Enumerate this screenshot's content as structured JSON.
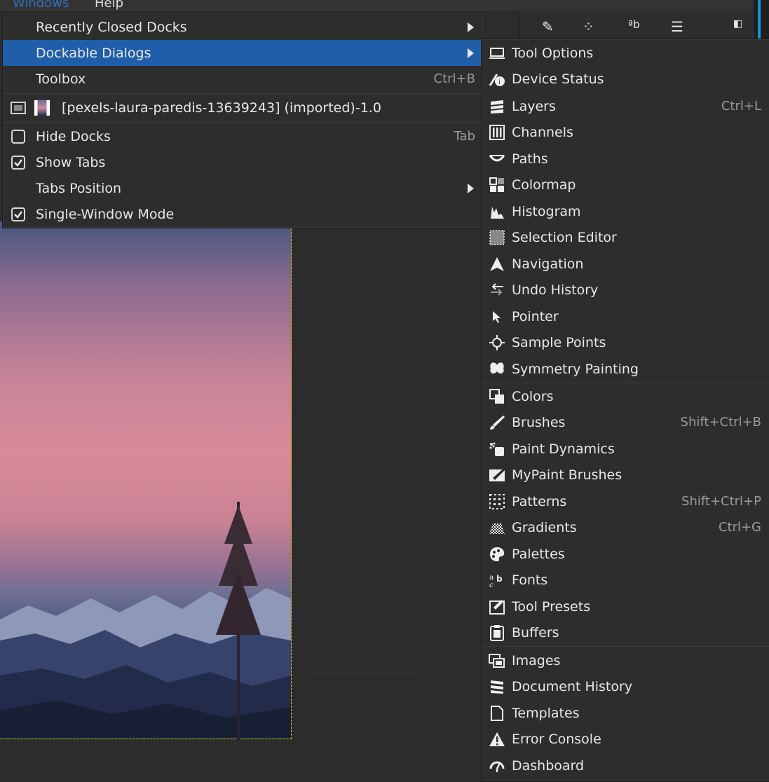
{
  "menubar": {
    "windows": "Windows",
    "help": "Help"
  },
  "windows_menu": {
    "items": [
      {
        "label": "Recently Closed Docks",
        "submenu": true
      },
      {
        "label": "Dockable Dialogs",
        "submenu": true,
        "active": true
      },
      {
        "label": "Toolbox",
        "shortcut": "Ctrl+B"
      },
      {
        "label": "[pexels-laura-paredis-13639243] (imported)-1.0"
      },
      {
        "label": "Hide Docks",
        "shortcut": "Tab",
        "checked": false
      },
      {
        "label": "Show Tabs",
        "checked": true
      },
      {
        "label": "Tabs Position",
        "submenu": true
      },
      {
        "label": "Single-Window Mode",
        "checked": true
      }
    ]
  },
  "dockable_dialogs": {
    "items": [
      {
        "label": "Tool Options",
        "icon": "tool-options-icon"
      },
      {
        "label": "Device Status",
        "icon": "device-status-icon"
      },
      {
        "label": "Layers",
        "shortcut": "Ctrl+L",
        "icon": "layers-icon"
      },
      {
        "label": "Channels",
        "icon": "channels-icon"
      },
      {
        "label": "Paths",
        "icon": "paths-icon"
      },
      {
        "label": "Colormap",
        "icon": "colormap-icon"
      },
      {
        "label": "Histogram",
        "icon": "histogram-icon"
      },
      {
        "label": "Selection Editor",
        "icon": "selection-editor-icon"
      },
      {
        "label": "Navigation",
        "icon": "navigation-icon"
      },
      {
        "label": "Undo History",
        "icon": "undo-history-icon"
      },
      {
        "label": "Pointer",
        "icon": "pointer-icon"
      },
      {
        "label": "Sample Points",
        "icon": "sample-points-icon"
      },
      {
        "label": "Symmetry Painting",
        "icon": "symmetry-painting-icon"
      },
      {
        "label": "Colors",
        "icon": "colors-icon"
      },
      {
        "label": "Brushes",
        "shortcut": "Shift+Ctrl+B",
        "icon": "brushes-icon"
      },
      {
        "label": "Paint Dynamics",
        "icon": "paint-dynamics-icon"
      },
      {
        "label": "MyPaint Brushes",
        "icon": "mypaint-brushes-icon"
      },
      {
        "label": "Patterns",
        "shortcut": "Shift+Ctrl+P",
        "icon": "patterns-icon"
      },
      {
        "label": "Gradients",
        "shortcut": "Ctrl+G",
        "icon": "gradients-icon"
      },
      {
        "label": "Palettes",
        "icon": "palettes-icon"
      },
      {
        "label": "Fonts",
        "icon": "fonts-icon"
      },
      {
        "label": "Tool Presets",
        "icon": "tool-presets-icon"
      },
      {
        "label": "Buffers",
        "icon": "buffers-icon"
      },
      {
        "label": "Images",
        "icon": "images-icon"
      },
      {
        "label": "Document History",
        "icon": "document-history-icon"
      },
      {
        "label": "Templates",
        "icon": "templates-icon"
      },
      {
        "label": "Error Console",
        "icon": "error-console-icon"
      },
      {
        "label": "Dashboard",
        "icon": "dashboard-icon"
      }
    ]
  },
  "colors": {
    "accent": "#1f5ea8",
    "selection_outline": "#e3d000",
    "menu_bg": "#2d2d2d"
  }
}
